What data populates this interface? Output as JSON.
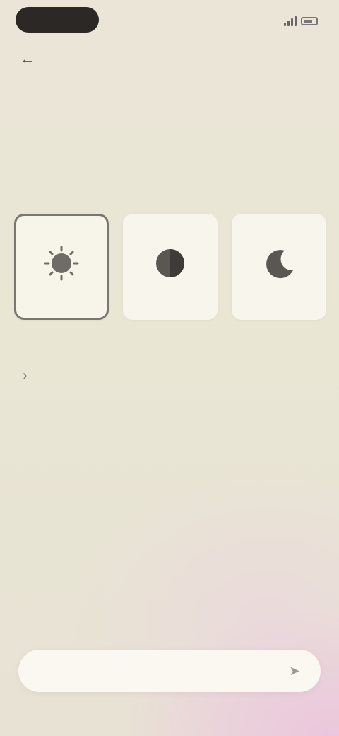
{
  "status_bar": {
    "pill_text": "",
    "right_text": ""
  },
  "nav": {
    "back_icon": "arrow-left-icon",
    "title": "",
    "action_label": ""
  },
  "step_label": "",
  "question": "",
  "options": [
    {
      "label": "",
      "icon": "sun-icon",
      "selected": true
    },
    {
      "label": "",
      "icon": "circle-icon",
      "selected": false
    },
    {
      "label": "",
      "icon": "moon-icon",
      "selected": false
    }
  ],
  "link": {
    "label": "",
    "icon": "chevron-right-icon"
  },
  "input": {
    "placeholder": "",
    "send_icon": "send-icon"
  },
  "colors": {
    "background": "#e9e6d4",
    "accent_gradient": "#ecc4de",
    "card": "#f8f5ec",
    "text": "#2a2522"
  }
}
